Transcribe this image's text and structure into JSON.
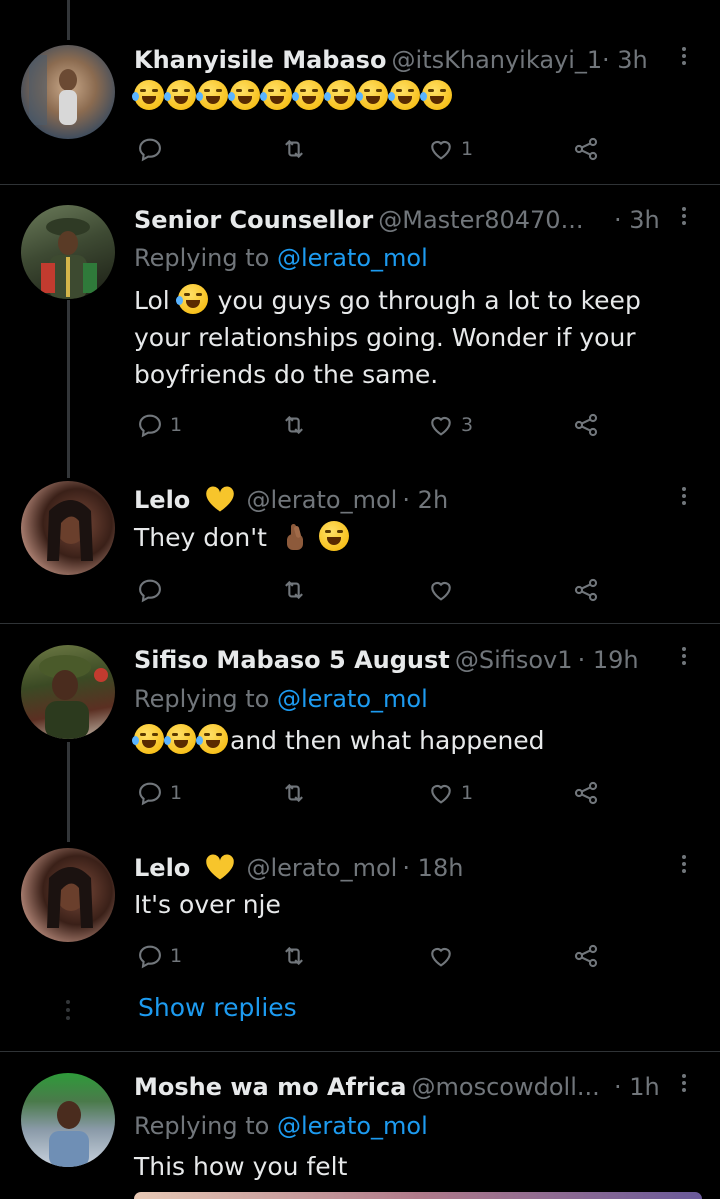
{
  "tweets": [
    {
      "name": "Khanyisile Mabaso",
      "handle": "@itsKhanyikayi_1",
      "time": "· 3h",
      "replying_to": "",
      "text": "",
      "emoji_count": 10,
      "replies": "",
      "likes": "1"
    },
    {
      "name": "Senior Counsellor",
      "handle": "@Master80470...",
      "time": "· 3h",
      "replying_label": "Replying to",
      "replying_to": "@lerato_mol",
      "text_prefix": "Lol",
      "text": "you guys go through a lot to keep your relationships going. Wonder if your boyfriends do the same.",
      "replies": "1",
      "likes": "3"
    },
    {
      "name": "Lelo",
      "handle": "@lerato_mol",
      "time": "· 2h",
      "text": "They don't",
      "replies": "",
      "likes": ""
    },
    {
      "name": "Sifiso Mabaso 5 August",
      "handle": "@Sifisov1",
      "time": "· 19h",
      "replying_label": "Replying to",
      "replying_to": "@lerato_mol",
      "text": "and then what happened",
      "replies": "1",
      "likes": "1"
    },
    {
      "name": "Lelo",
      "handle": "@lerato_mol",
      "time": "· 18h",
      "text": "It's over nje",
      "replies": "1",
      "likes": ""
    },
    {
      "name": "Moshe wa mo Africa",
      "handle": "@moscowdoll...",
      "time": "· 1h",
      "replying_label": "Replying to",
      "replying_to": "@lerato_mol",
      "text": "This how you felt"
    }
  ],
  "show_replies": "Show replies",
  "colors": {
    "background": "#000000",
    "text": "#e7e9ea",
    "muted": "#71767b",
    "link": "#1d9bf0",
    "divider": "#2f3336"
  },
  "icons": {
    "reply": "reply-icon",
    "retweet": "retweet-icon",
    "like": "heart-icon",
    "share": "share-icon",
    "more": "more-icon"
  }
}
